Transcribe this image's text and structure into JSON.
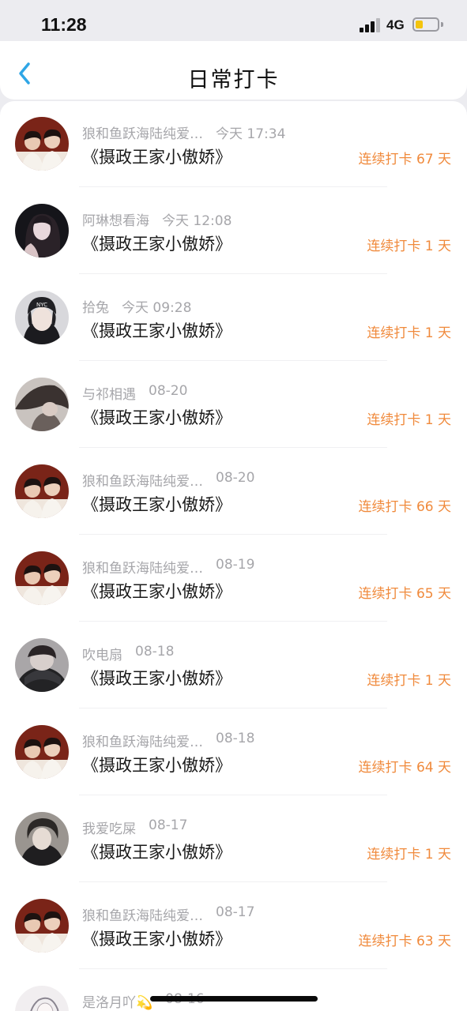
{
  "status_bar": {
    "time": "11:28",
    "network": "4G",
    "battery_color": "#f4c40e"
  },
  "nav": {
    "back_icon": "chevron-left-icon",
    "title": "日常打卡"
  },
  "colors": {
    "accent": "#2fa6e6",
    "streak": "#f08a3c"
  },
  "entries": [
    {
      "user": "狼和鱼跃海陆纯爱…",
      "time": "今天 17:34",
      "book": "《摄政王家小傲娇》",
      "streak": "连续打卡 67 天",
      "avatar": "couple"
    },
    {
      "user": "阿琳想看海",
      "time": "今天 12:08",
      "book": "《摄政王家小傲娇》",
      "streak": "连续打卡 1 天",
      "avatar": "dark-girl"
    },
    {
      "user": "拾兔",
      "time": "今天 09:28",
      "book": "《摄政王家小傲娇》",
      "streak": "连续打卡 1 天",
      "avatar": "cap"
    },
    {
      "user": "与祁相遇",
      "time": "08-20",
      "book": "《摄政王家小傲娇》",
      "streak": "连续打卡 1 天",
      "avatar": "hair"
    },
    {
      "user": "狼和鱼跃海陆纯爱…",
      "time": "08-20",
      "book": "《摄政王家小傲娇》",
      "streak": "连续打卡 66 天",
      "avatar": "couple"
    },
    {
      "user": "狼和鱼跃海陆纯爱…",
      "time": "08-19",
      "book": "《摄政王家小傲娇》",
      "streak": "连续打卡 65 天",
      "avatar": "couple"
    },
    {
      "user": "吹电扇",
      "time": "08-18",
      "book": "《摄政王家小傲娇》",
      "streak": "连续打卡 1 天",
      "avatar": "coat"
    },
    {
      "user": "狼和鱼跃海陆纯爱…",
      "time": "08-18",
      "book": "《摄政王家小傲娇》",
      "streak": "连续打卡 64 天",
      "avatar": "couple"
    },
    {
      "user": "我爱吃屎",
      "time": "08-17",
      "book": "《摄政王家小傲娇》",
      "streak": "连续打卡 1 天",
      "avatar": "boy"
    },
    {
      "user": "狼和鱼跃海陆纯爱…",
      "time": "08-17",
      "book": "《摄政王家小傲娇》",
      "streak": "连续打卡 63 天",
      "avatar": "couple"
    },
    {
      "user": "是洛月吖💫",
      "time": "08-16",
      "book": "",
      "streak": "",
      "avatar": "sketch"
    }
  ]
}
